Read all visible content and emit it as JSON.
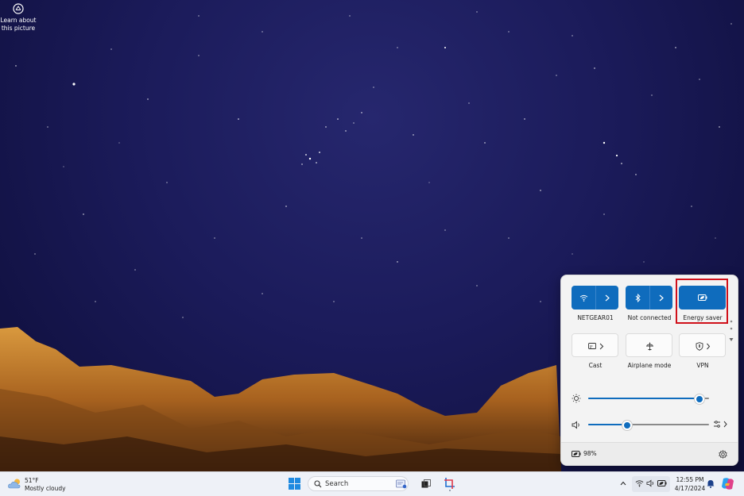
{
  "desktop": {
    "learn_label_line1": "Learn about",
    "learn_label_line2": "this picture"
  },
  "quick_settings": {
    "tiles": [
      {
        "label": "NETGEAR01",
        "icon": "wifi-icon",
        "state": "on",
        "has_arrow": true
      },
      {
        "label": "Not connected",
        "icon": "bluetooth-icon",
        "state": "on",
        "has_arrow": true
      },
      {
        "label": "Energy saver",
        "icon": "energy-saver-icon",
        "state": "on",
        "has_arrow": false,
        "highlighted": true
      },
      {
        "label": "Cast",
        "icon": "cast-icon",
        "state": "off",
        "has_arrow": true
      },
      {
        "label": "Airplane mode",
        "icon": "airplane-icon",
        "state": "off",
        "has_arrow": false
      },
      {
        "label": "VPN",
        "icon": "vpn-shield-icon",
        "state": "off",
        "has_arrow": true
      }
    ],
    "brightness_level": 0.92,
    "volume_level": 0.32,
    "battery_text": "98%",
    "accent_color": "#0f6cbd",
    "highlight_color": "#d0101a"
  },
  "taskbar": {
    "weather_temp": "51°F",
    "weather_desc": "Mostly cloudy",
    "search_placeholder": "Search",
    "time": "12:55 PM",
    "date": "4/17/2024"
  }
}
